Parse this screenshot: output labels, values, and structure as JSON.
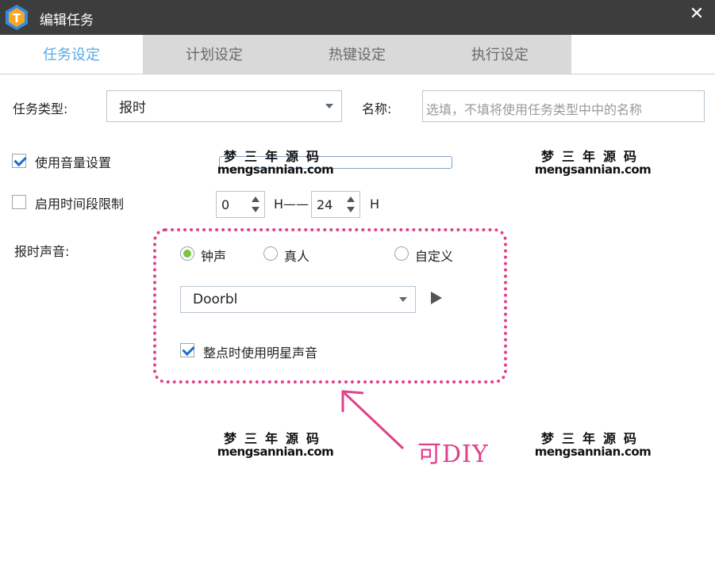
{
  "window": {
    "title": "编辑任务",
    "close_glyph": "✕",
    "icon_letter": "T"
  },
  "tabs": [
    {
      "label": "任务设定",
      "active": true
    },
    {
      "label": "计划设定",
      "active": false
    },
    {
      "label": "热键设定",
      "active": false
    },
    {
      "label": "执行设定",
      "active": false
    }
  ],
  "form": {
    "task_type_label": "任务类型:",
    "task_type_value": "报时",
    "name_label": "名称:",
    "name_placeholder": "选填，不填将使用任务类型中中的名称",
    "volume_checkbox_label": "使用音量设置",
    "volume_checked": true,
    "period_checkbox_label": "启用时间段限制",
    "period_checked": false,
    "period_start": "0",
    "period_separator": "H——",
    "period_end": "24",
    "period_unit": "H",
    "sound_label": "报时声音:",
    "radios": [
      {
        "label": "钟声",
        "selected": true
      },
      {
        "label": "真人",
        "selected": false
      },
      {
        "label": "自定义",
        "selected": false
      }
    ],
    "sound_select_value": "Doorbl",
    "star_voice_label": "整点时使用明星声音",
    "star_voice_checked": true
  },
  "annotation": {
    "text": "可DIY",
    "color": "#e0408a"
  },
  "watermark": {
    "cn": "梦三年源码",
    "en": "mengsannian.com"
  },
  "colors": {
    "titlebar": "#3d3d3d",
    "active_tab": "#5aa9e6",
    "radio_on": "#7fc241",
    "check": "#1a6fc9"
  }
}
